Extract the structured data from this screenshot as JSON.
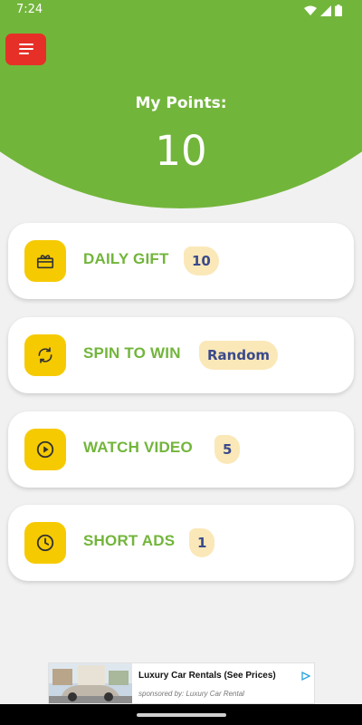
{
  "status_bar": {
    "time": "7:24"
  },
  "header": {
    "points_label": "My Points:",
    "points_value": "10"
  },
  "cards": [
    {
      "title": "DAILY GIFT",
      "badge": "10",
      "icon": "gift-icon"
    },
    {
      "title": "SPIN TO WIN",
      "badge": "Random",
      "icon": "refresh-icon"
    },
    {
      "title": "WATCH VIDEO",
      "badge": "5",
      "icon": "play-circle-icon"
    },
    {
      "title": "SHORT ADS",
      "badge": "1",
      "icon": "clock-icon"
    }
  ],
  "ad": {
    "title": "Luxury Car Rentals (See Prices)",
    "sponsor": "sponsored by: Luxury Car Rental"
  },
  "colors": {
    "brand_green": "#72b53b",
    "menu_red": "#e63027",
    "icon_yellow": "#f6ca00",
    "badge_bg": "#fbe8b8",
    "badge_text": "#3a4a8c"
  }
}
